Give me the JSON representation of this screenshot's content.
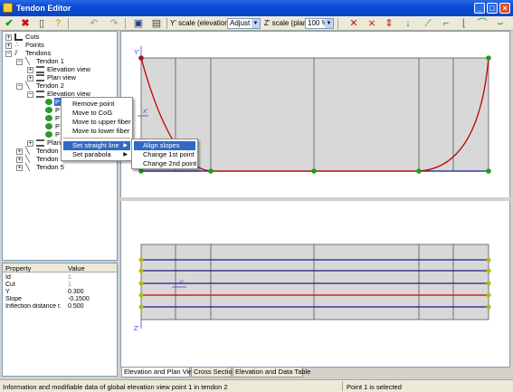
{
  "window": {
    "title": "Tendon Editor",
    "minimize": "_",
    "maximize": "□",
    "close": "×"
  },
  "toolbar": {
    "y_scale_label": "Y' scale (elevation)",
    "y_scale_value": "Adjust",
    "z_scale_label": "Z' scale (plan)",
    "z_scale_value": "100 %"
  },
  "tree": {
    "cuts": "Cuts",
    "points": "Points",
    "tendons": "Tendons",
    "tendon1": "Tendon 1",
    "t1_elevation": "Elevation view",
    "t1_plan": "Plan view",
    "tendon2": "Tendon 2",
    "t2_elevation": "Elevation view",
    "t2_plan": "Plan v",
    "point1": "P",
    "point2": "P",
    "point3": "P",
    "point4": "P",
    "point5": "P",
    "tendon3": "Tendon 3",
    "tendon4": "Tendon 4",
    "tendon5": "Tendon 5"
  },
  "context_menu": {
    "remove_point": "Remove point",
    "move_to_cog": "Move to CoG",
    "move_upper": "Move to upper fiber",
    "move_lower": "Move to lower fiber",
    "set_straight": "Set straight line",
    "set_parabola": "Set parabola"
  },
  "submenu": {
    "align_slopes": "Align slopes",
    "change_1st": "Change 1st point",
    "change_2nd": "Change 2nd point"
  },
  "properties": {
    "header_property": "Property",
    "header_value": "Value",
    "rows": [
      {
        "name": "Id",
        "value": "1"
      },
      {
        "name": "Cut",
        "value": "1"
      },
      {
        "name": "Y",
        "value": "0.300"
      },
      {
        "name": "Slope",
        "value": "-0.1500"
      },
      {
        "name": "Inflection distance r...",
        "value": "0.500"
      }
    ]
  },
  "plot": {
    "elev_axis_label": "Y'",
    "elev_x_label": "X'",
    "plan_axis_label": "Z'",
    "plan_x_label": "X'"
  },
  "tabs": [
    "Elevation and Plan Views",
    "Cross Section",
    "Elevation and Data Table"
  ],
  "status": {
    "message": "Information and modifiable data of global elevation view point 1 in tendon 2",
    "selection": "Point 1 is selected"
  },
  "colors": {
    "tendon_red": "#c00000",
    "tendon_blue": "#1a1a8c",
    "point_green": "#1aa01a",
    "point_yellow": "#b8b800",
    "beam_fill": "#d8d8d8"
  }
}
